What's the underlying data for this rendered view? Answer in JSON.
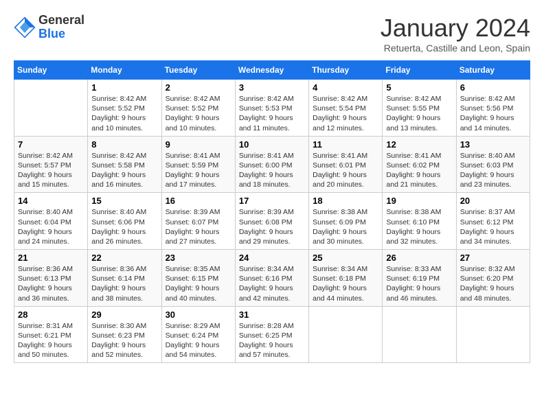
{
  "logo": {
    "general": "General",
    "blue": "Blue"
  },
  "title": "January 2024",
  "subtitle": "Retuerta, Castille and Leon, Spain",
  "weekdays": [
    "Sunday",
    "Monday",
    "Tuesday",
    "Wednesday",
    "Thursday",
    "Friday",
    "Saturday"
  ],
  "weeks": [
    [
      {
        "day": "",
        "info": ""
      },
      {
        "day": "1",
        "info": "Sunrise: 8:42 AM\nSunset: 5:52 PM\nDaylight: 9 hours\nand 10 minutes."
      },
      {
        "day": "2",
        "info": "Sunrise: 8:42 AM\nSunset: 5:52 PM\nDaylight: 9 hours\nand 10 minutes."
      },
      {
        "day": "3",
        "info": "Sunrise: 8:42 AM\nSunset: 5:53 PM\nDaylight: 9 hours\nand 11 minutes."
      },
      {
        "day": "4",
        "info": "Sunrise: 8:42 AM\nSunset: 5:54 PM\nDaylight: 9 hours\nand 12 minutes."
      },
      {
        "day": "5",
        "info": "Sunrise: 8:42 AM\nSunset: 5:55 PM\nDaylight: 9 hours\nand 13 minutes."
      },
      {
        "day": "6",
        "info": "Sunrise: 8:42 AM\nSunset: 5:56 PM\nDaylight: 9 hours\nand 14 minutes."
      }
    ],
    [
      {
        "day": "7",
        "info": "Sunrise: 8:42 AM\nSunset: 5:57 PM\nDaylight: 9 hours\nand 15 minutes."
      },
      {
        "day": "8",
        "info": "Sunrise: 8:42 AM\nSunset: 5:58 PM\nDaylight: 9 hours\nand 16 minutes."
      },
      {
        "day": "9",
        "info": "Sunrise: 8:41 AM\nSunset: 5:59 PM\nDaylight: 9 hours\nand 17 minutes."
      },
      {
        "day": "10",
        "info": "Sunrise: 8:41 AM\nSunset: 6:00 PM\nDaylight: 9 hours\nand 18 minutes."
      },
      {
        "day": "11",
        "info": "Sunrise: 8:41 AM\nSunset: 6:01 PM\nDaylight: 9 hours\nand 20 minutes."
      },
      {
        "day": "12",
        "info": "Sunrise: 8:41 AM\nSunset: 6:02 PM\nDaylight: 9 hours\nand 21 minutes."
      },
      {
        "day": "13",
        "info": "Sunrise: 8:40 AM\nSunset: 6:03 PM\nDaylight: 9 hours\nand 23 minutes."
      }
    ],
    [
      {
        "day": "14",
        "info": "Sunrise: 8:40 AM\nSunset: 6:04 PM\nDaylight: 9 hours\nand 24 minutes."
      },
      {
        "day": "15",
        "info": "Sunrise: 8:40 AM\nSunset: 6:06 PM\nDaylight: 9 hours\nand 26 minutes."
      },
      {
        "day": "16",
        "info": "Sunrise: 8:39 AM\nSunset: 6:07 PM\nDaylight: 9 hours\nand 27 minutes."
      },
      {
        "day": "17",
        "info": "Sunrise: 8:39 AM\nSunset: 6:08 PM\nDaylight: 9 hours\nand 29 minutes."
      },
      {
        "day": "18",
        "info": "Sunrise: 8:38 AM\nSunset: 6:09 PM\nDaylight: 9 hours\nand 30 minutes."
      },
      {
        "day": "19",
        "info": "Sunrise: 8:38 AM\nSunset: 6:10 PM\nDaylight: 9 hours\nand 32 minutes."
      },
      {
        "day": "20",
        "info": "Sunrise: 8:37 AM\nSunset: 6:12 PM\nDaylight: 9 hours\nand 34 minutes."
      }
    ],
    [
      {
        "day": "21",
        "info": "Sunrise: 8:36 AM\nSunset: 6:13 PM\nDaylight: 9 hours\nand 36 minutes."
      },
      {
        "day": "22",
        "info": "Sunrise: 8:36 AM\nSunset: 6:14 PM\nDaylight: 9 hours\nand 38 minutes."
      },
      {
        "day": "23",
        "info": "Sunrise: 8:35 AM\nSunset: 6:15 PM\nDaylight: 9 hours\nand 40 minutes."
      },
      {
        "day": "24",
        "info": "Sunrise: 8:34 AM\nSunset: 6:16 PM\nDaylight: 9 hours\nand 42 minutes."
      },
      {
        "day": "25",
        "info": "Sunrise: 8:34 AM\nSunset: 6:18 PM\nDaylight: 9 hours\nand 44 minutes."
      },
      {
        "day": "26",
        "info": "Sunrise: 8:33 AM\nSunset: 6:19 PM\nDaylight: 9 hours\nand 46 minutes."
      },
      {
        "day": "27",
        "info": "Sunrise: 8:32 AM\nSunset: 6:20 PM\nDaylight: 9 hours\nand 48 minutes."
      }
    ],
    [
      {
        "day": "28",
        "info": "Sunrise: 8:31 AM\nSunset: 6:21 PM\nDaylight: 9 hours\nand 50 minutes."
      },
      {
        "day": "29",
        "info": "Sunrise: 8:30 AM\nSunset: 6:23 PM\nDaylight: 9 hours\nand 52 minutes."
      },
      {
        "day": "30",
        "info": "Sunrise: 8:29 AM\nSunset: 6:24 PM\nDaylight: 9 hours\nand 54 minutes."
      },
      {
        "day": "31",
        "info": "Sunrise: 8:28 AM\nSunset: 6:25 PM\nDaylight: 9 hours\nand 57 minutes."
      },
      {
        "day": "",
        "info": ""
      },
      {
        "day": "",
        "info": ""
      },
      {
        "day": "",
        "info": ""
      }
    ]
  ]
}
